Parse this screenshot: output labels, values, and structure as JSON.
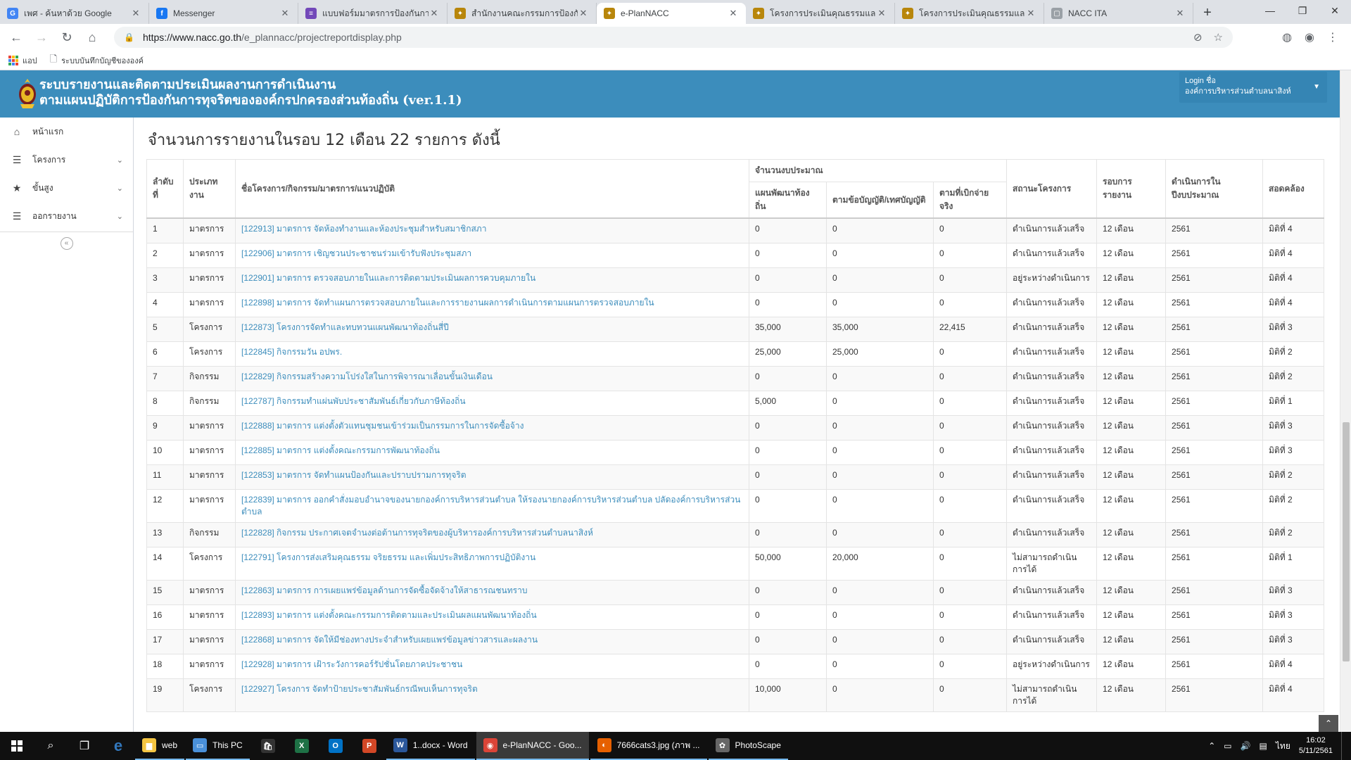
{
  "browser": {
    "tabs": [
      {
        "label": "เพศ - ค้นหาด้วย Google",
        "icon": "google-icon",
        "color": "#4285f4",
        "glyph": "G",
        "active": false
      },
      {
        "label": "Messenger",
        "icon": "facebook-icon",
        "color": "#1877f2",
        "glyph": "f",
        "active": false
      },
      {
        "label": "แบบฟอร์มมาตรการป้องกันการทุ",
        "icon": "forms-icon",
        "color": "#7248b9",
        "glyph": "≡",
        "active": false
      },
      {
        "label": "สำนักงานคณะกรรมการป้องกันแ",
        "icon": "nacc-icon",
        "color": "#b8860b",
        "glyph": "✦",
        "active": false
      },
      {
        "label": "e-PlanNACC",
        "icon": "nacc-icon",
        "color": "#b8860b",
        "glyph": "✦",
        "active": true
      },
      {
        "label": "โครงการประเมินคุณธรรมและควา",
        "icon": "nacc-icon",
        "color": "#b8860b",
        "glyph": "✦",
        "active": false
      },
      {
        "label": "โครงการประเมินคุณธรรมและควา",
        "icon": "nacc-icon",
        "color": "#b8860b",
        "glyph": "✦",
        "active": false
      },
      {
        "label": "NACC ITA",
        "icon": "page-icon",
        "color": "#9aa0a6",
        "glyph": "▢",
        "active": false
      }
    ],
    "new_tab": "+",
    "url_host": "https://www.nacc.go.th",
    "url_path": "/e_plannacc/projectreportdisplay.php",
    "bookmarks": [
      {
        "label": "แอป",
        "icon": "apps-icon"
      },
      {
        "label": "ระบบบันทึกบัญชีขององค์",
        "icon": "page-icon"
      }
    ]
  },
  "site": {
    "title_line1": "ระบบรายงานและติดตามประเมินผลงานการดำเนินงาน",
    "title_line2": "ตามแผนปฏิบัติการป้องกันการทุจริตขององค์กรปกครองส่วนท้องถิ่น (ver.1.1)",
    "login_label": "Login ชื่อ",
    "login_name": "องค์การบริหารส่วนตำบลนาสิงห์"
  },
  "sidebar": {
    "items": [
      {
        "label": "หน้าแรก",
        "icon": "home-icon",
        "glyph": "⌂",
        "expandable": false
      },
      {
        "label": "โครงการ",
        "icon": "list-icon",
        "glyph": "☰",
        "expandable": true
      },
      {
        "label": "ขั้นสูง",
        "icon": "star-icon",
        "glyph": "★",
        "expandable": true
      },
      {
        "label": "ออกรายงาน",
        "icon": "list-icon",
        "glyph": "☰",
        "expandable": true
      }
    ],
    "collapse": "«"
  },
  "report": {
    "heading": "จำนวนการรายงานในรอบ 12 เดือน 22 รายการ ดังนี้",
    "headers": {
      "no": "ลำดับที่",
      "type": "ประเภทงาน",
      "name": "ชื่อโครงการ/กิจกรรม/มาตรการ/แนวปฏิบัติ",
      "budget": "จำนวนงบประมาณ",
      "plan": "แผนพัฒนาท้องถิ่น",
      "ordinance": "ตามข้อบัญญัติ/เทศบัญญัติ",
      "actual": "ตามที่เบิกจ่ายจริง",
      "status": "สถานะโครงการ",
      "round": "รอบการรายงาน",
      "year": "ดำเนินการในปีงบประมาณ",
      "dimension": "สอดคล้อง"
    },
    "rows": [
      {
        "no": "1",
        "type": "มาตรการ",
        "name": "[122913] มาตรการ จัดห้องทำงานและห้องประชุมสำหรับสมาชิกสภา",
        "plan": "0",
        "ordinance": "0",
        "actual": "0",
        "status": "ดำเนินการแล้วเสร็จ",
        "round": "12 เดือน",
        "year": "2561",
        "dimension": "มิติที่ 4"
      },
      {
        "no": "2",
        "type": "มาตรการ",
        "name": "[122906] มาตรการ เชิญชวนประชาชนร่วมเข้ารับฟังประชุมสภา",
        "plan": "0",
        "ordinance": "0",
        "actual": "0",
        "status": "ดำเนินการแล้วเสร็จ",
        "round": "12 เดือน",
        "year": "2561",
        "dimension": "มิติที่ 4"
      },
      {
        "no": "3",
        "type": "มาตรการ",
        "name": "[122901] มาตรการ ตรวจสอบภายในและการติดตามประเมินผลการควบคุมภายใน",
        "plan": "0",
        "ordinance": "0",
        "actual": "0",
        "status": "อยู่ระหว่างดำเนินการ",
        "round": "12 เดือน",
        "year": "2561",
        "dimension": "มิติที่ 4"
      },
      {
        "no": "4",
        "type": "มาตรการ",
        "name": "[122898] มาตรการ จัดทำแผนการตรวจสอบภายในและการรายงานผลการดำเนินการตามแผนการตรวจสอบภายใน",
        "plan": "0",
        "ordinance": "0",
        "actual": "0",
        "status": "ดำเนินการแล้วเสร็จ",
        "round": "12 เดือน",
        "year": "2561",
        "dimension": "มิติที่ 4"
      },
      {
        "no": "5",
        "type": "โครงการ",
        "name": "[122873] โครงการจัดทำและทบทวนแผนพัฒนาท้องถิ่นสี่ปี",
        "plan": "35,000",
        "ordinance": "35,000",
        "actual": "22,415",
        "status": "ดำเนินการแล้วเสร็จ",
        "round": "12 เดือน",
        "year": "2561",
        "dimension": "มิติที่ 3"
      },
      {
        "no": "6",
        "type": "โครงการ",
        "name": "[122845] กิจกรรมวัน อปพร.",
        "plan": "25,000",
        "ordinance": "25,000",
        "actual": "0",
        "status": "ดำเนินการแล้วเสร็จ",
        "round": "12 เดือน",
        "year": "2561",
        "dimension": "มิติที่ 2"
      },
      {
        "no": "7",
        "type": "กิจกรรม",
        "name": "[122829] กิจกรรมสร้างความโปร่งใสในการพิจารณาเลื่อนขั้นเงินเดือน",
        "plan": "0",
        "ordinance": "0",
        "actual": "0",
        "status": "ดำเนินการแล้วเสร็จ",
        "round": "12 เดือน",
        "year": "2561",
        "dimension": "มิติที่ 2"
      },
      {
        "no": "8",
        "type": "กิจกรรม",
        "name": "[122787] กิจกรรมทำแผ่นพับประชาสัมพันธ์เกี่ยวกับภาษีท้องถิ่น",
        "plan": "5,000",
        "ordinance": "0",
        "actual": "0",
        "status": "ดำเนินการแล้วเสร็จ",
        "round": "12 เดือน",
        "year": "2561",
        "dimension": "มิติที่ 1"
      },
      {
        "no": "9",
        "type": "มาตรการ",
        "name": "[122888] มาตรการ แต่งตั้งตัวแทนชุมชนเข้าร่วมเป็นกรรมการในการจัดซื้อจ้าง",
        "plan": "0",
        "ordinance": "0",
        "actual": "0",
        "status": "ดำเนินการแล้วเสร็จ",
        "round": "12 เดือน",
        "year": "2561",
        "dimension": "มิติที่ 3"
      },
      {
        "no": "10",
        "type": "มาตรการ",
        "name": "[122885] มาตรการ แต่งตั้งคณะกรรมการพัฒนาท้องถิ่น",
        "plan": "0",
        "ordinance": "0",
        "actual": "0",
        "status": "ดำเนินการแล้วเสร็จ",
        "round": "12 เดือน",
        "year": "2561",
        "dimension": "มิติที่ 3"
      },
      {
        "no": "11",
        "type": "มาตรการ",
        "name": "[122853] มาตรการ จัดทำแผนป้องกันและปราบปรามการทุจริต",
        "plan": "0",
        "ordinance": "0",
        "actual": "0",
        "status": "ดำเนินการแล้วเสร็จ",
        "round": "12 เดือน",
        "year": "2561",
        "dimension": "มิติที่ 2"
      },
      {
        "no": "12",
        "type": "มาตรการ",
        "name": "[122839] มาตรการ ออกคำสั่งมอบอำนาจของนายกองค์การบริหารส่วนตำบล ให้รองนายกองค์การบริหารส่วนตำบล ปลัดองค์การบริหารส่วนตำบล",
        "plan": "0",
        "ordinance": "0",
        "actual": "0",
        "status": "ดำเนินการแล้วเสร็จ",
        "round": "12 เดือน",
        "year": "2561",
        "dimension": "มิติที่ 2"
      },
      {
        "no": "13",
        "type": "กิจกรรม",
        "name": "[122828] กิจกรรม ประกาศเจตจำนงต่อต้านการทุจริตของผู้บริหารองค์การบริหารส่วนตำบลนาสิงห์",
        "plan": "0",
        "ordinance": "0",
        "actual": "0",
        "status": "ดำเนินการแล้วเสร็จ",
        "round": "12 เดือน",
        "year": "2561",
        "dimension": "มิติที่ 2"
      },
      {
        "no": "14",
        "type": "โครงการ",
        "name": "[122791] โครงการส่งเสริมคุณธรรม จริยธรรม และเพิ่มประสิทธิภาพการปฏิบัติงาน",
        "plan": "50,000",
        "ordinance": "20,000",
        "actual": "0",
        "status": "ไม่สามารถดำเนินการได้",
        "round": "12 เดือน",
        "year": "2561",
        "dimension": "มิติที่ 1"
      },
      {
        "no": "15",
        "type": "มาตรการ",
        "name": "[122863] มาตรการ การเผยแพร่ข้อมูลด้านการจัดซื้อจัดจ้างให้สาธารณชนทราบ",
        "plan": "0",
        "ordinance": "0",
        "actual": "0",
        "status": "ดำเนินการแล้วเสร็จ",
        "round": "12 เดือน",
        "year": "2561",
        "dimension": "มิติที่ 3"
      },
      {
        "no": "16",
        "type": "มาตรการ",
        "name": "[122893] มาตรการ แต่งตั้งคณะกรรมการติดตามและประเมินผลแผนพัฒนาท้องถิ่น",
        "plan": "0",
        "ordinance": "0",
        "actual": "0",
        "status": "ดำเนินการแล้วเสร็จ",
        "round": "12 เดือน",
        "year": "2561",
        "dimension": "มิติที่ 3"
      },
      {
        "no": "17",
        "type": "มาตรการ",
        "name": "[122868] มาตรการ จัดให้มีช่องทางประจำสำหรับเผยแพร่ข้อมูลข่าวสารและผลงาน",
        "plan": "0",
        "ordinance": "0",
        "actual": "0",
        "status": "ดำเนินการแล้วเสร็จ",
        "round": "12 เดือน",
        "year": "2561",
        "dimension": "มิติที่ 3"
      },
      {
        "no": "18",
        "type": "มาตรการ",
        "name": "[122928] มาตรการ เฝ้าระวังการคอร์รัปชั่นโดยภาคประชาชน",
        "plan": "0",
        "ordinance": "0",
        "actual": "0",
        "status": "อยู่ระหว่างดำเนินการ",
        "round": "12 เดือน",
        "year": "2561",
        "dimension": "มิติที่ 4"
      },
      {
        "no": "19",
        "type": "โครงการ",
        "name": "[122927] โครงการ จัดทำป้ายประชาสัมพันธ์กรณีพบเห็นการทุจริต",
        "plan": "10,000",
        "ordinance": "0",
        "actual": "0",
        "status": "ไม่สามารถดำเนินการได้",
        "round": "12 เดือน",
        "year": "2561",
        "dimension": "มิติที่ 4"
      }
    ]
  },
  "taskbar": {
    "apps": [
      {
        "label": "web",
        "icon": "folder-icon",
        "color": "#f4c542",
        "glyph": "▆",
        "state": "open"
      },
      {
        "label": "This PC",
        "icon": "computer-icon",
        "color": "#4a90d9",
        "glyph": "▭",
        "state": "open"
      },
      {
        "label": "",
        "icon": "store-icon",
        "color": "#333333",
        "glyph": "🛍",
        "state": "pinned"
      },
      {
        "label": "",
        "icon": "excel-icon",
        "color": "#1e7145",
        "glyph": "X",
        "state": "pinned"
      },
      {
        "label": "",
        "icon": "outlook-icon",
        "color": "#0072c6",
        "glyph": "O",
        "state": "pinned"
      },
      {
        "label": "",
        "icon": "powerpoint-icon",
        "color": "#d24726",
        "glyph": "P",
        "state": "pinned"
      },
      {
        "label": "1..docx - Word",
        "icon": "word-icon",
        "color": "#2b579a",
        "glyph": "W",
        "state": "open"
      },
      {
        "label": "e-PlanNACC - Goo...",
        "icon": "chrome-icon",
        "color": "#db4437",
        "glyph": "◉",
        "state": "active"
      },
      {
        "label": "7666cats3.jpg (ภาพ ...",
        "icon": "firefox-icon",
        "color": "#e66000",
        "glyph": "◐",
        "state": "open"
      },
      {
        "label": "PhotoScape",
        "icon": "photoscape-icon",
        "color": "#666666",
        "glyph": "✿",
        "state": "open"
      }
    ],
    "lang": "ไทย",
    "time": "16:02",
    "date": "5/11/2561"
  }
}
